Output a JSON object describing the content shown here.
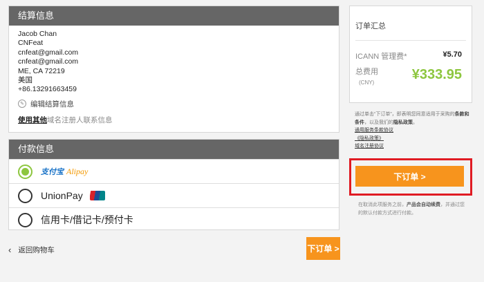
{
  "billing": {
    "title": "结算信息",
    "address_lines": [
      "Jacob Chan",
      "CNFeat",
      "cnfeat@gmail.com",
      "cnfeat@gmail.com",
      "ME, CA  72219",
      "美国",
      "+86.13291663459"
    ],
    "edit_label": "编辑结算信息",
    "use_other_link": "使用其他",
    "use_other_text": "域名注册人联系信息"
  },
  "payment": {
    "title": "付款信息",
    "options": [
      {
        "label": "Alipay",
        "logo_zh": "支付宝",
        "selected": true
      },
      {
        "label": "UnionPay",
        "selected": false
      },
      {
        "label": "信用卡/借记卡/预付卡",
        "selected": false
      }
    ]
  },
  "nav": {
    "back_label": "返回购物车",
    "order_button": "下订单 >"
  },
  "summary": {
    "title": "订单汇总",
    "fee_label": "ICANN 管理费*",
    "fee_amount": "¥5.70",
    "total_label": "总费用",
    "total_currency": "(CNY)",
    "total_amount": "¥333.95"
  },
  "terms": {
    "text_a": "通过单击“下订单”，即表明您同意适用于采购的",
    "bold_a": "条款和条件",
    "text_b": "，以及我们的",
    "bold_b": "隐私政策",
    "text_c": "。",
    "links": [
      "通用服务条款协议",
      "《隐私政策》",
      "域名注册协议"
    ]
  },
  "main_order_button": "下订单 >",
  "note": {
    "text_a": "在取消此项服务之前，",
    "bold": "产品会自动续费",
    "text_b": "，并通过您的默认付款方式进行付款。"
  },
  "colors": {
    "accent_orange": "#f7941d",
    "total_green": "#8dc63f",
    "highlight_red": "#e01b23",
    "header_gray": "#666666"
  }
}
